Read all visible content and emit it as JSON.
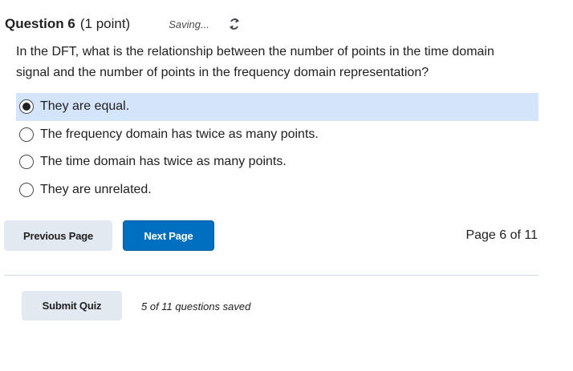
{
  "question": {
    "title": "Question 6",
    "points": "(1 point)",
    "saving_status": "Saving...",
    "text": "In the DFT, what is the relationship between the number of points in the time domain signal and the number of points in the frequency domain representation?"
  },
  "options": [
    {
      "label": "They are equal.",
      "selected": true
    },
    {
      "label": "The frequency domain has twice as many points.",
      "selected": false
    },
    {
      "label": "The time domain has twice as many points.",
      "selected": false
    },
    {
      "label": "They are unrelated.",
      "selected": false
    }
  ],
  "navigation": {
    "previous_label": "Previous Page",
    "next_label": "Next Page",
    "page_indicator": "Page 6 of 11"
  },
  "footer": {
    "submit_label": "Submit Quiz",
    "saved_status": "5 of 11 questions saved"
  },
  "colors": {
    "primary": "#006fbf",
    "secondary_button": "#e3e9f1",
    "selected_option_bg": "#d4e4fa"
  },
  "icons": {
    "saving": "sync-arrows-icon"
  }
}
